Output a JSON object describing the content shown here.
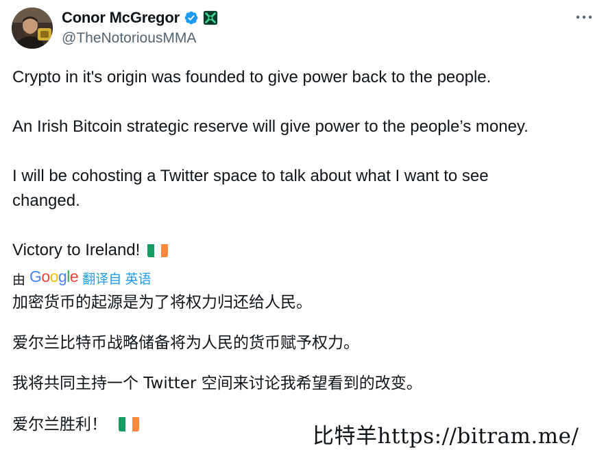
{
  "author": {
    "display_name": "Conor McGregor",
    "handle": "@TheNotoriousMMA",
    "verified": true,
    "badge_color": "#1d9bf0"
  },
  "tweet": {
    "line1": "Crypto in it's origin was founded to give power back to the people.",
    "line2": "An Irish Bitcoin strategic reserve will give power to the people’s money.",
    "line3": "I will be cohosting a Twitter space to talk about what I want to see changed.",
    "line4": "Victory to Ireland!",
    "flag_icon": "ireland-flag-icon"
  },
  "translation": {
    "by_label": "由",
    "provider": "Google",
    "translated_from": "翻译自 英语",
    "line1": "加密货币的起源是为了将权力归还给人民。",
    "line2": "爱尔兰比特币战略储备将为人民的货币赋予权力。",
    "line3": "我将共同主持一个 Twitter 空间来讨论我希望看到的改变。",
    "line4": "爱尔兰胜利！"
  },
  "watermark": "比特羊https://bitram.me/"
}
